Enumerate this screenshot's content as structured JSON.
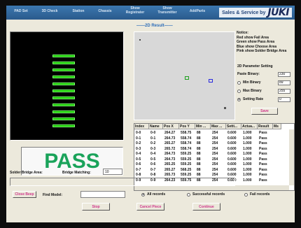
{
  "titlebar": {
    "tabs": [
      "PAD Set",
      "3D Check",
      "Station",
      "Chassis",
      "Show Registrater",
      "Show Transmitter",
      "AddParts"
    ],
    "brand_text": "Sales & Service by",
    "brand_logo": "JUKI"
  },
  "result_label": "2D Result",
  "notes": {
    "title": "Notice:",
    "lines": [
      "Red show Fail Area",
      "Green show Pass Area",
      "Blue show Choose Area",
      "Pink show Solder Bridge Area"
    ]
  },
  "param": {
    "title": "2D Parameter Setting",
    "paste_binary_label": "Paste Binary:",
    "paste_binary_value": "230",
    "min_binary_label": "Min Binary",
    "min_binary_value": "89",
    "max_binary_label": "Max Binary",
    "max_binary_value": "255",
    "setting_rate_label": "Setting Rate",
    "setting_rate_value": "0",
    "selected_option": "Setting Rate",
    "save_label": "Save"
  },
  "table": {
    "headers": [
      "Index",
      "Name",
      "Pos X",
      "Pos Y",
      "Min ...",
      "Max ...",
      "Setti...",
      "Actua...",
      "Result",
      "Ms"
    ],
    "rows": [
      [
        "0-0",
        "0-0",
        "264.27",
        "558.75",
        "88",
        "254",
        "0.600",
        "1.000",
        "Pass"
      ],
      [
        "0-1",
        "0-1",
        "264.73",
        "558.74",
        "88",
        "254",
        "0.600",
        "1.000",
        "Pass"
      ],
      [
        "0-2",
        "0-2",
        "265.27",
        "558.74",
        "88",
        "254",
        "0.600",
        "1.000",
        "Pass"
      ],
      [
        "0-3",
        "0-3",
        "265.72",
        "558.74",
        "88",
        "254",
        "0.600",
        "1.000",
        "Pass"
      ],
      [
        "0-4",
        "0-4",
        "264.73",
        "559.25",
        "88",
        "254",
        "0.600",
        "1.000",
        "Pass"
      ],
      [
        "0-5",
        "0-5",
        "264.73",
        "559.25",
        "88",
        "254",
        "0.600",
        "1.000",
        "Pass"
      ],
      [
        "0-6",
        "0-6",
        "265.25",
        "559.25",
        "88",
        "254",
        "0.600",
        "1.000",
        "Pass"
      ],
      [
        "0-7",
        "0-7",
        "265.27",
        "568.25",
        "88",
        "254",
        "0.600",
        "1.000",
        "Pass"
      ],
      [
        "0-8",
        "0-8",
        "265.73",
        "559.25",
        "88",
        "254",
        "0.600",
        "1.000",
        "Pass"
      ],
      [
        "0-9",
        "0-9",
        "264.23",
        "559.75",
        "88",
        "254",
        "0.600",
        "1.000",
        "Pass"
      ]
    ]
  },
  "status": "PASS",
  "solder_bridge": {
    "area_label": "Solder Bridge Area:",
    "matching_label": "Bridge Matching:",
    "matching_value": "10"
  },
  "controls": {
    "close_beep": "Close Beep",
    "find_model_label": "Find Model:",
    "find_model_value": "",
    "stop": "Stop",
    "cancel_piece": "Cancel Piece",
    "continue": "Continue"
  },
  "filters": {
    "options": [
      "All records",
      "Successful records",
      "Fail records"
    ],
    "selected": "All records"
  },
  "colors": {
    "pass_green": "#1aa35a",
    "pad_green": "#16c000",
    "accent_pink": "#d0368a",
    "title_blue": "#2b6cb8"
  }
}
